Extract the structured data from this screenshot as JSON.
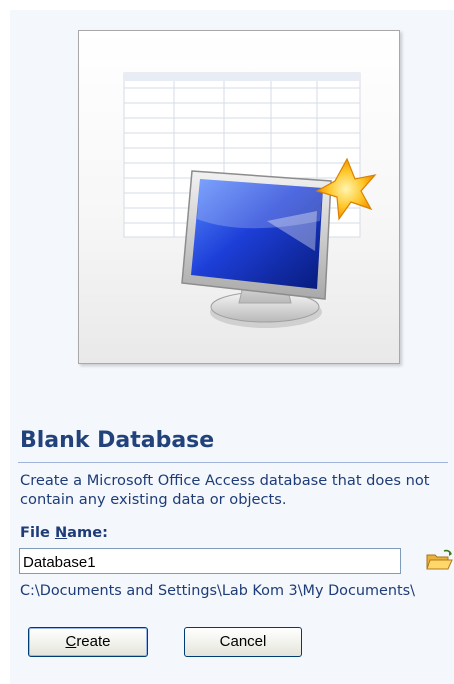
{
  "template": {
    "title": "Blank Database",
    "description": "Create a Microsoft Office Access database that does not contain any existing data or objects.",
    "preview_icon": "database-monitor-icon"
  },
  "file_name": {
    "label_prefix": "File ",
    "label_accel": "N",
    "label_rest": "ame:",
    "value": "Database1",
    "browse_icon": "folder-open-icon"
  },
  "save_path": "C:\\Documents and Settings\\Lab Kom 3\\My Documents\\",
  "buttons": {
    "create_accel": "C",
    "create_rest": "reate",
    "cancel": "Cancel"
  }
}
